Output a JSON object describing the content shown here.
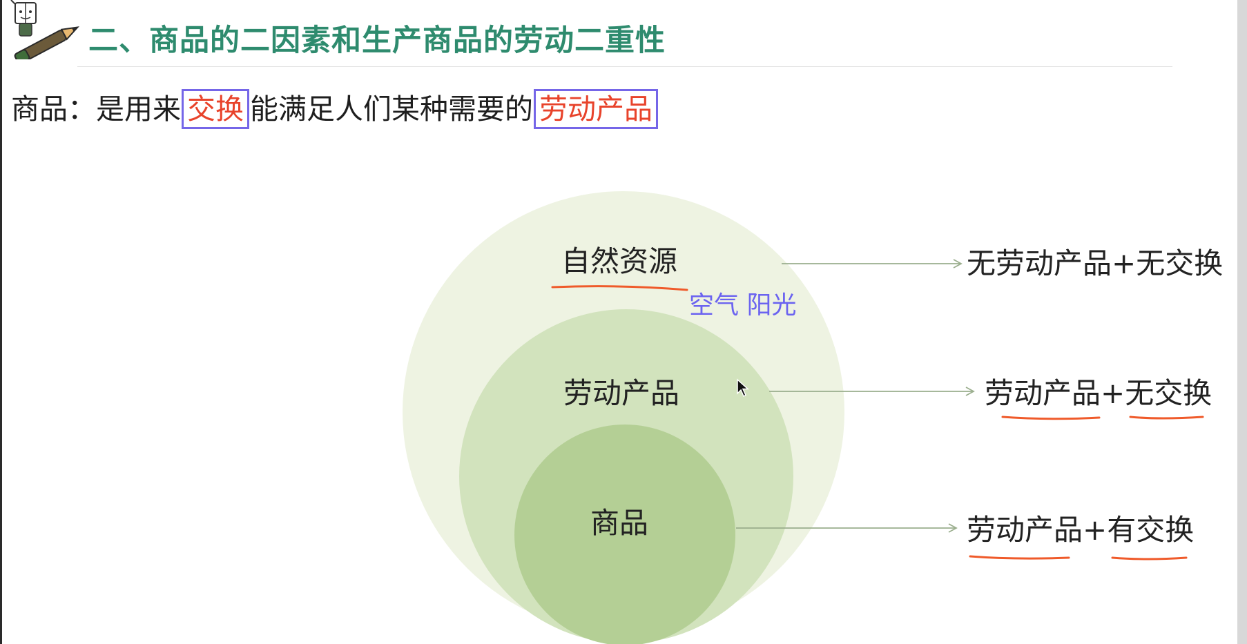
{
  "title": "二、商品的二因素和生产商品的劳动二重性",
  "definition": {
    "prefix": "商品：是用来",
    "highlight_1": "交换",
    "middle": "能满足人们某种需要的",
    "highlight_2": "劳动产品"
  },
  "diagram": {
    "outer_label": "自然资源",
    "outer_examples": "空气 阳光",
    "middle_label": "劳动产品",
    "inner_label": "商品",
    "outer_result": "无劳动产品+无交换",
    "middle_result": "劳动产品+无交换",
    "inner_result": "劳动产品+有交换"
  },
  "colors": {
    "title": "#2e8b6e",
    "highlight_text": "#e8432b",
    "highlight_box": "#7566e8",
    "examples_text": "#6b63f0",
    "underline": "#ef5a2a",
    "outer_circle": "#eef3e2",
    "middle_circle": "#d2e3bd",
    "inner_circle": "#b4cf95",
    "arrow": "#9aae8d"
  },
  "icons": {
    "logo": "pencil-and-book-mascot-icon",
    "cursor": "mouse-pointer-icon"
  }
}
